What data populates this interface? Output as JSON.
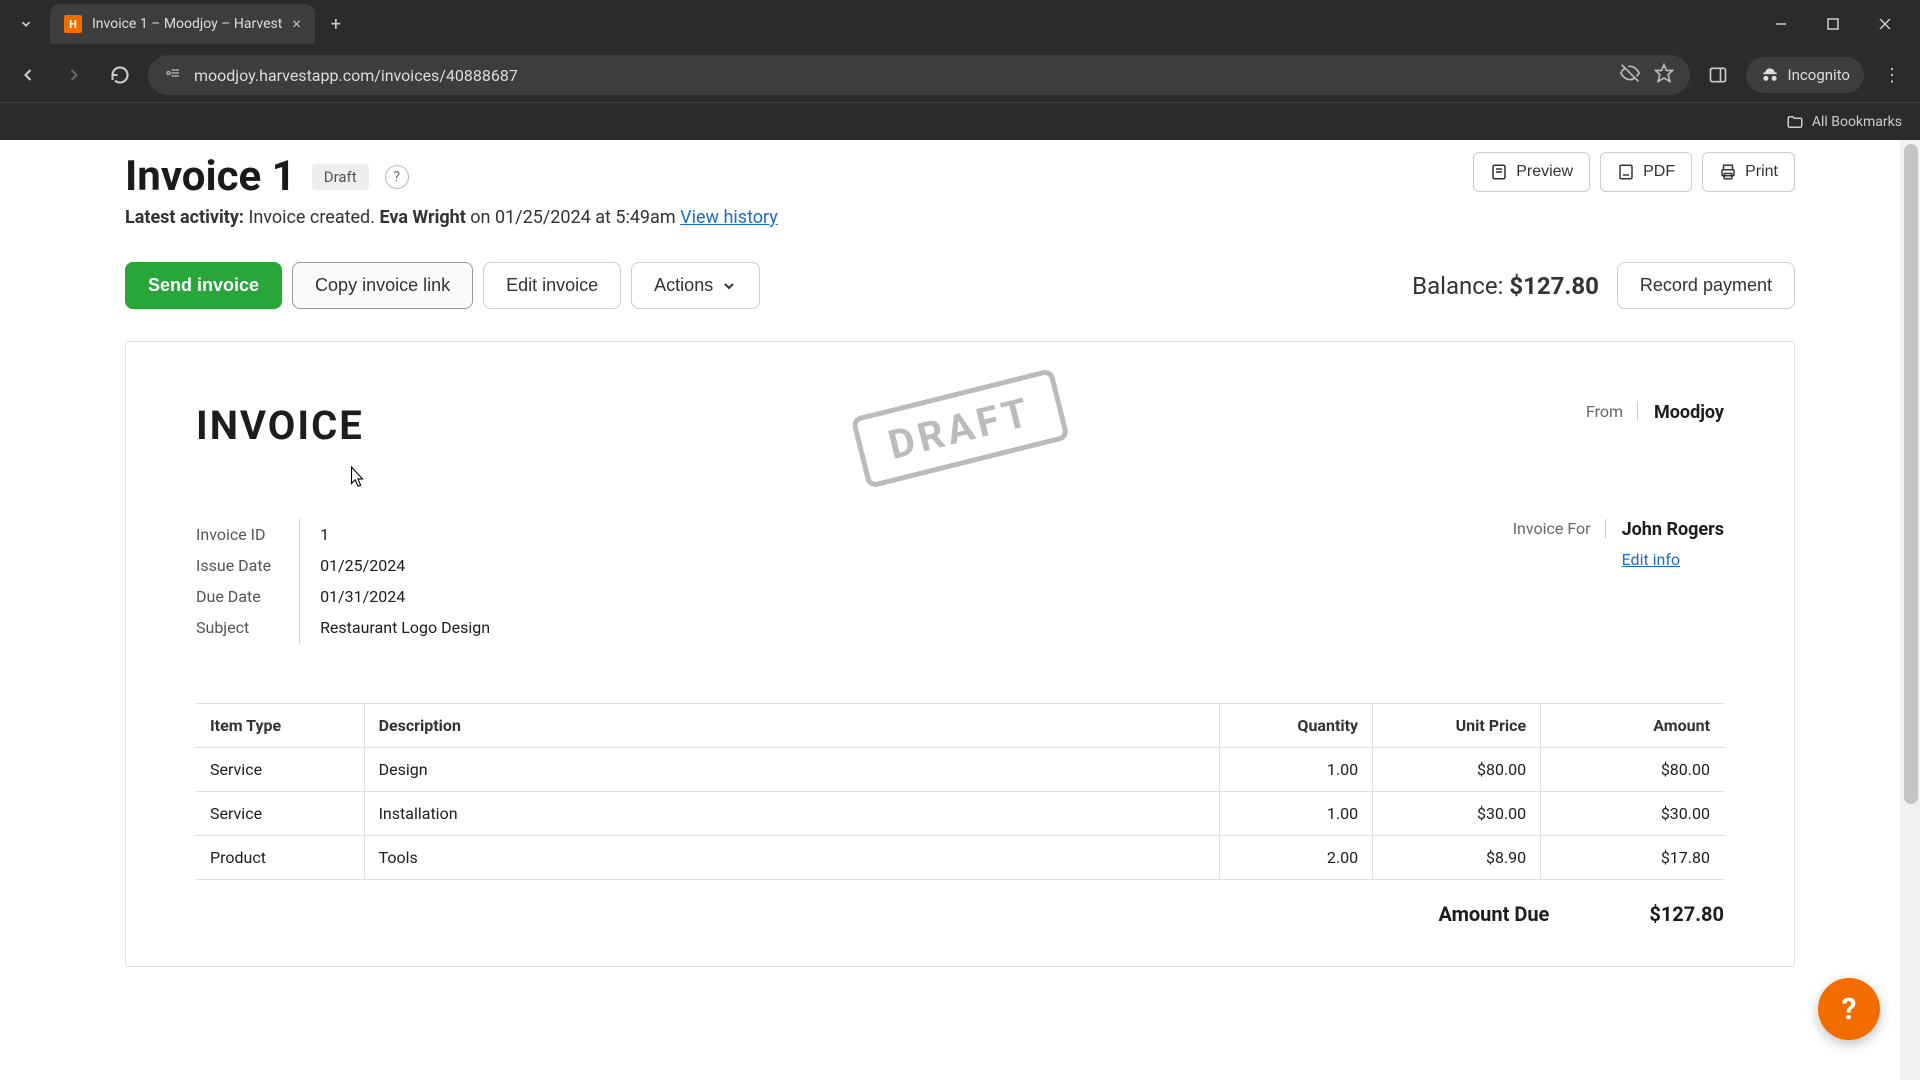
{
  "browser": {
    "tab_title": "Invoice 1 – Moodjoy – Harvest",
    "tab_favicon": "H",
    "url": "moodjoy.harvestapp.com/invoices/40888687",
    "incognito_label": "Incognito",
    "bookmarks_label": "All Bookmarks"
  },
  "header": {
    "title": "Invoice 1",
    "status_pill": "Draft",
    "help": "?",
    "doc_buttons": {
      "preview": "Preview",
      "pdf": "PDF",
      "print": "Print"
    }
  },
  "activity": {
    "label": "Latest activity:",
    "text": "Invoice created.",
    "actor": "Eva Wright",
    "meta": "on 01/25/2024 at 5:49am",
    "history_link": "View history"
  },
  "actions": {
    "send": "Send invoice",
    "copy": "Copy invoice link",
    "edit": "Edit invoice",
    "more": "Actions",
    "balance_label": "Balance:",
    "balance_value": "$127.80",
    "record_payment": "Record payment"
  },
  "invoice": {
    "heading": "INVOICE",
    "stamp": "DRAFT",
    "from_label": "From",
    "from_value": "Moodjoy",
    "for_label": "Invoice For",
    "for_value": "John Rogers",
    "edit_info": "Edit info",
    "meta": {
      "id_label": "Invoice ID",
      "id": "1",
      "issue_label": "Issue Date",
      "issue": "01/25/2024",
      "due_label": "Due Date",
      "due": "01/31/2024",
      "subject_label": "Subject",
      "subject": "Restaurant Logo Design"
    },
    "table": {
      "headers": {
        "type": "Item Type",
        "desc": "Description",
        "qty": "Quantity",
        "price": "Unit Price",
        "amount": "Amount"
      },
      "rows": [
        {
          "type": "Service",
          "desc": "Design",
          "qty": "1.00",
          "price": "$80.00",
          "amount": "$80.00"
        },
        {
          "type": "Service",
          "desc": "Installation",
          "qty": "1.00",
          "price": "$30.00",
          "amount": "$30.00"
        },
        {
          "type": "Product",
          "desc": "Tools",
          "qty": "2.00",
          "price": "$8.90",
          "amount": "$17.80"
        }
      ]
    },
    "amount_due_label": "Amount Due",
    "amount_due_value": "$127.80"
  },
  "fab": {
    "help": "?"
  }
}
